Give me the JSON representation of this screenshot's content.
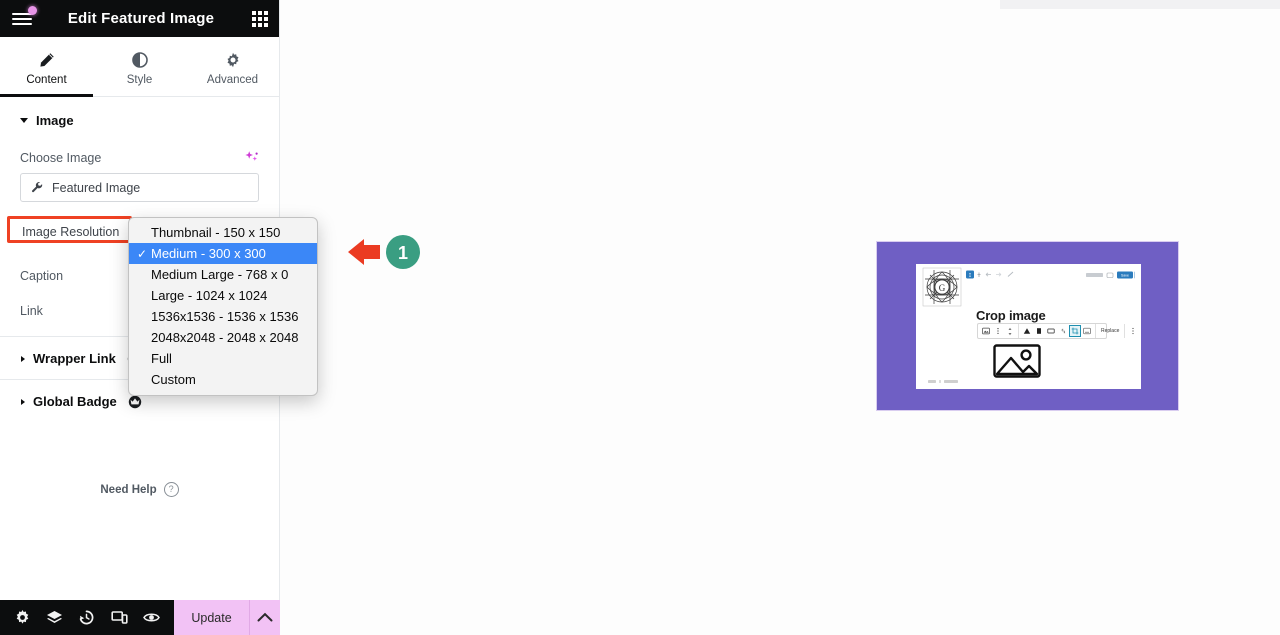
{
  "panel": {
    "header": {
      "title": "Edit Featured Image",
      "menu_icon": "hamburger-icon",
      "apps_icon": "apps-grid-icon",
      "badge_color": "#e894e8"
    },
    "tabs": [
      {
        "label": "Content",
        "icon": "pencil-icon",
        "active": true
      },
      {
        "label": "Style",
        "icon": "contrast-circle-icon",
        "active": false
      },
      {
        "label": "Advanced",
        "icon": "gear-icon",
        "active": false
      }
    ],
    "sections": [
      {
        "title": "Image",
        "expanded": true,
        "pro": false
      },
      {
        "title": "Wrapper Link",
        "expanded": false,
        "pro": true
      },
      {
        "title": "Global Badge",
        "expanded": false,
        "pro": true
      }
    ],
    "image_section": {
      "choose_image_label": "Choose Image",
      "ai_icon": "ai-sparkle-icon",
      "media_value": "Featured Image",
      "media_icon": "wrench-icon",
      "resolution_label": "Image Resolution",
      "resolution_highlight_color": "#ef4123",
      "caption_label": "Caption",
      "link_label": "Link"
    },
    "need_help": {
      "label": "Need Help",
      "icon": "question-circle-icon"
    },
    "footer": {
      "tools": [
        {
          "name": "settings-icon"
        },
        {
          "name": "layers-icon"
        },
        {
          "name": "history-icon"
        },
        {
          "name": "responsive-icon"
        },
        {
          "name": "preview-eye-icon"
        }
      ],
      "update_label": "Update",
      "update_color": "#f2c2f5",
      "chevron_icon": "chevron-up-icon"
    }
  },
  "dropdown": {
    "name": "image-resolution-select",
    "selected": "Medium - 300 x 300",
    "highlight_color": "#3b87f7",
    "options": [
      {
        "label": "Thumbnail - 150 x 150",
        "selected": false
      },
      {
        "label": "Medium - 300 x 300",
        "selected": true
      },
      {
        "label": "Medium Large - 768 x 0",
        "selected": false
      },
      {
        "label": "Large - 1024 x 1024",
        "selected": false
      },
      {
        "label": "1536x1536 - 1536 x 1536",
        "selected": false
      },
      {
        "label": "2048x2048 - 2048 x 2048",
        "selected": false
      },
      {
        "label": "Full",
        "selected": false
      },
      {
        "label": "Custom",
        "selected": false
      }
    ]
  },
  "annotation": {
    "step_number": "1",
    "arrow_color": "#eb3b22",
    "badge_color": "#3a9e82"
  },
  "preview": {
    "background_color": "#6f5fc4",
    "inner_title": "Crop image",
    "replace_label": "Replace",
    "logo_letter": "G",
    "image_placeholder_icon": "image-placeholder-icon"
  }
}
